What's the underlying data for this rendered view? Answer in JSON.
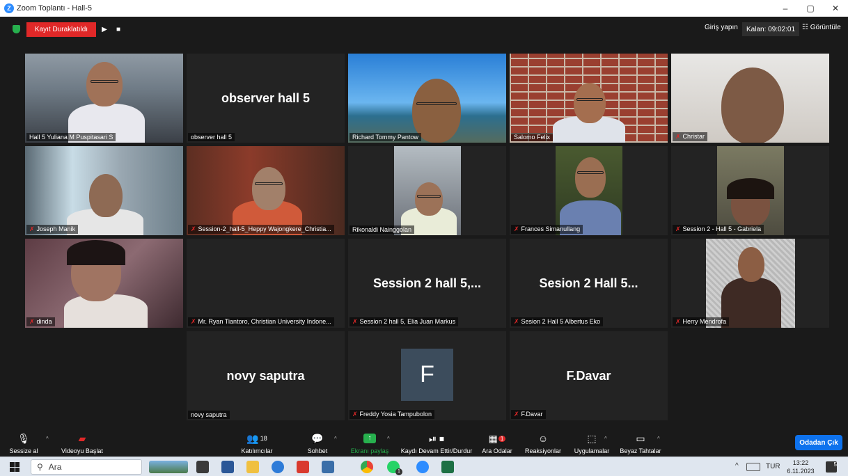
{
  "window": {
    "title": "Zoom Toplantı - Hall-5",
    "minimize": "–",
    "maximize": "▢",
    "close": "✕"
  },
  "topbar": {
    "recording_status": "Kayıt Duraklatıldı",
    "play_glyph": "▶",
    "stop_glyph": "■",
    "signin": "Giriş yapın",
    "remaining": "Kalan: 09:02:01",
    "view": "Görüntüle"
  },
  "participants": [
    {
      "label": "Hall 5 Yuliana M Puspitasari S",
      "muted": false,
      "big_name": ""
    },
    {
      "label": "observer hall 5",
      "muted": false,
      "big_name": "observer hall 5"
    },
    {
      "label": "Richard Tommy Pantow",
      "muted": false,
      "big_name": ""
    },
    {
      "label": "Salomo Felix",
      "muted": false,
      "big_name": ""
    },
    {
      "label": "Christar",
      "muted": true,
      "big_name": ""
    },
    {
      "label": "Joseph Manik",
      "muted": true,
      "big_name": ""
    },
    {
      "label": "Session-2_hall-5_Heppy Wajongkere_Christia...",
      "muted": true,
      "big_name": ""
    },
    {
      "label": "Rikonaldi Nainggolan",
      "muted": false,
      "big_name": ""
    },
    {
      "label": "Frances Simanullang",
      "muted": true,
      "big_name": ""
    },
    {
      "label": "Session 2 - Hall 5 - Gabriela",
      "muted": true,
      "big_name": ""
    },
    {
      "label": "dinda",
      "muted": true,
      "big_name": ""
    },
    {
      "label": "Mr. Ryan Tiantoro, Christian University Indone...",
      "muted": true,
      "big_name": ""
    },
    {
      "label": "Session 2 hall 5, Elia Juan Markus",
      "muted": true,
      "big_name": "Session 2 hall 5,..."
    },
    {
      "label": "Sesion 2 Hall 5 Albertus Eko",
      "muted": true,
      "big_name": "Sesion 2 Hall 5..."
    },
    {
      "label": "Herry Mendrofa",
      "muted": true,
      "big_name": ""
    },
    {
      "label": "novy saputra",
      "muted": false,
      "big_name": "novy saputra"
    },
    {
      "label": "Freddy Yosia Tampubolon",
      "muted": true,
      "big_name": "",
      "initial": "F"
    },
    {
      "label": "F.Davar",
      "muted": true,
      "big_name": "F.Davar"
    }
  ],
  "toolbar": {
    "mute": "Sessize al",
    "video": "Videoyu Başlat",
    "participants": "Katılımcılar",
    "participants_count": "18",
    "chat": "Sohbet",
    "share": "Ekranı paylaş",
    "record": "Kaydı Devam Ettir/Durdur",
    "breakout": "Ara Odalar",
    "breakout_badge": "1",
    "reactions": "Reaksiyonlar",
    "apps": "Uygulamalar",
    "whiteboard": "Beyaz Tahtalar",
    "leave": "Odadan Çık"
  },
  "taskbar": {
    "search_placeholder": "Ara",
    "language": "TUR",
    "time": "13:22",
    "date": "6.11.2023",
    "notifications": "5",
    "whatsapp_badge": "1"
  },
  "colors": {
    "accent": "#0e72ed",
    "record_red": "#e02828",
    "active_speaker": "#e1e66a",
    "share_green": "#27b04e"
  }
}
